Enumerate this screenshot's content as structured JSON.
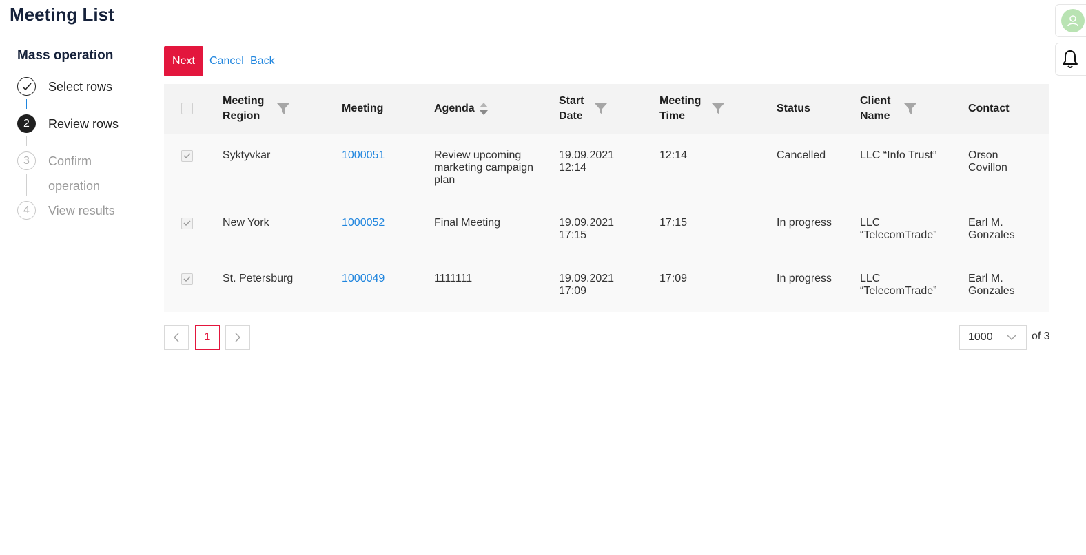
{
  "page": {
    "title": "Meeting List"
  },
  "stepper": {
    "title": "Mass operation",
    "steps": [
      {
        "number": "1",
        "label": "Select rows",
        "state": "done"
      },
      {
        "number": "2",
        "label": "Review rows",
        "state": "active"
      },
      {
        "number": "3",
        "label": "Confirm operation",
        "label_line1": "Confirm",
        "label_line2": "operation",
        "state": "todo"
      },
      {
        "number": "4",
        "label": "View results",
        "state": "todo"
      }
    ]
  },
  "toolbar": {
    "next_label": "Next",
    "cancel_label": "Cancel",
    "back_label": "Back"
  },
  "table": {
    "columns": {
      "region": {
        "line1": "Meeting",
        "line2": "Region"
      },
      "meeting": "Meeting",
      "agenda": "Agenda",
      "start_date": {
        "line1": "Start",
        "line2": "Date"
      },
      "meeting_time": {
        "line1": "Meeting",
        "line2": "Time"
      },
      "status": "Status",
      "client_name": {
        "line1": "Client",
        "line2": "Name"
      },
      "contact": "Contact"
    },
    "rows": [
      {
        "checked": true,
        "region": "Syktyvkar",
        "meeting": "1000051",
        "agenda": [
          "Review upcoming",
          "marketing campaign",
          "plan"
        ],
        "start_date": [
          "19.09.2021",
          "12:14"
        ],
        "time": "12:14",
        "status": "Cancelled",
        "client": [
          "LLC “Info Trust”"
        ],
        "contact": [
          "Orson",
          "Covillon"
        ]
      },
      {
        "checked": true,
        "region": "New York",
        "meeting": "1000052",
        "agenda": [
          "Final Meeting"
        ],
        "start_date": [
          "19.09.2021",
          "17:15"
        ],
        "time": "17:15",
        "status": "In progress",
        "client": [
          "LLC",
          "“TelecomTrade”"
        ],
        "contact": [
          "Earl M.",
          "Gonzales"
        ]
      },
      {
        "checked": true,
        "region": "St. Petersburg",
        "meeting": "1000049",
        "agenda": [
          "1111111"
        ],
        "start_date": [
          "19.09.2021",
          "17:09"
        ],
        "time": "17:09",
        "status": "In progress",
        "client": [
          "LLC",
          "“TelecomTrade”"
        ],
        "contact": [
          "Earl M.",
          "Gonzales"
        ]
      }
    ]
  },
  "pagination": {
    "current_page": "1",
    "page_size": "1000",
    "total_label": "of 3"
  },
  "colors": {
    "accent": "#e3163d",
    "link": "#1f85de",
    "title": "#15213a"
  },
  "icons": [
    "user-icon",
    "bell-icon",
    "check-icon",
    "filter-icon",
    "sort-icon",
    "chevron-left-icon",
    "chevron-right-icon",
    "chevron-down-icon"
  ]
}
